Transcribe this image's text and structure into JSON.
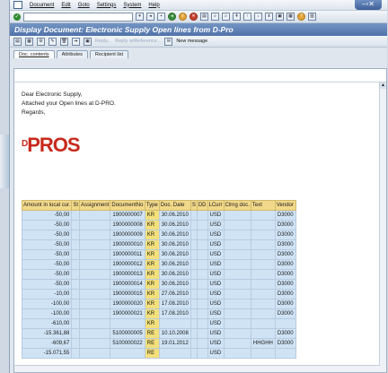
{
  "menu": [
    "Document",
    "Edit",
    "Goto",
    "Settings",
    "System",
    "Help"
  ],
  "title": "Display Document: Electronic Supply Open lines from D-Pro",
  "app_toolbar": {
    "reply": "Reply...",
    "reply_ref": "Reply w/Reference...",
    "new_message": "New message"
  },
  "tabs": [
    "Doc. contents",
    "Attributes",
    "Recipient list"
  ],
  "letter": [
    "Dear Electronic Supply,",
    "Attached your Open lines at D-PRO.",
    "Regards,"
  ],
  "logo": {
    "pre": "D",
    "main": "PROS"
  },
  "table": {
    "headers": [
      "Amount in local cur.",
      "St",
      "Assignment",
      "DocumentNo",
      "Type",
      "Doc. Date",
      "S",
      "DD",
      "LCurr",
      "Clrng doc.",
      "Text",
      "Vendor"
    ],
    "rows": [
      [
        "-50,00",
        "",
        "",
        "1900000007",
        "KR",
        "30.06.2010",
        "",
        "",
        "USD",
        "",
        "",
        "D3000"
      ],
      [
        "-50,00",
        "",
        "",
        "1900000008",
        "KR",
        "30.06.2010",
        "",
        "",
        "USD",
        "",
        "",
        "D3000"
      ],
      [
        "-50,00",
        "",
        "",
        "1900000009",
        "KR",
        "30.06.2010",
        "",
        "",
        "USD",
        "",
        "",
        "D3000"
      ],
      [
        "-50,00",
        "",
        "",
        "1900000010",
        "KR",
        "30.06.2010",
        "",
        "",
        "USD",
        "",
        "",
        "D3000"
      ],
      [
        "-50,00",
        "",
        "",
        "1900000011",
        "KR",
        "30.06.2010",
        "",
        "",
        "USD",
        "",
        "",
        "D3000"
      ],
      [
        "-50,00",
        "",
        "",
        "1900000012",
        "KR",
        "30.06.2010",
        "",
        "",
        "USD",
        "",
        "",
        "D3000"
      ],
      [
        "-50,00",
        "",
        "",
        "1900000013",
        "KR",
        "30.06.2010",
        "",
        "",
        "USD",
        "",
        "",
        "D3000"
      ],
      [
        "-50,00",
        "",
        "",
        "1900000014",
        "KR",
        "30.06.2010",
        "",
        "",
        "USD",
        "",
        "",
        "D3000"
      ],
      [
        "-10,00",
        "",
        "",
        "1900000015",
        "KR",
        "27.06.2010",
        "",
        "",
        "USD",
        "",
        "",
        "D3000"
      ],
      [
        "-100,00",
        "",
        "",
        "1900000020",
        "KR",
        "17.08.2010",
        "",
        "",
        "USD",
        "",
        "",
        "D3000"
      ],
      [
        "-100,00",
        "",
        "",
        "1900000021",
        "KR",
        "17.08.2010",
        "",
        "",
        "USD",
        "",
        "",
        "D3000"
      ],
      [
        "-610,00",
        "",
        "",
        "",
        "KR",
        "",
        "",
        "",
        "USD",
        "",
        "",
        ""
      ],
      [
        "-15.361,88",
        "",
        "",
        "5100000005",
        "RE",
        "10.10.2008",
        "",
        "",
        "USD",
        "",
        "",
        "D3000"
      ],
      [
        "-609,67",
        "",
        "",
        "5100000022",
        "RE",
        "19.01.2012",
        "",
        "",
        "USD",
        "",
        "HHGHH",
        "D3000"
      ],
      [
        "-15.071,55",
        "",
        "",
        "",
        "RE",
        "",
        "",
        "",
        "USD",
        "",
        "",
        ""
      ]
    ]
  }
}
